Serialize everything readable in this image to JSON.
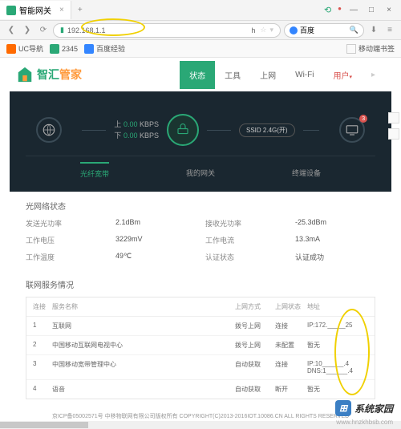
{
  "window": {
    "tab_title": "智能网关",
    "close": "×",
    "min": "—",
    "max": "□",
    "new_tab": "+"
  },
  "addr": {
    "back": "❮",
    "fwd": "❯",
    "reload": "⟳",
    "url": "192.168.1.1",
    "url_suffix": "h",
    "star": "☆",
    "search_engine": "百度",
    "search_icon": "🔍",
    "menu": "≡",
    "dl": "⬇"
  },
  "bookmarks": {
    "uc": "UC导航",
    "num": "2345",
    "baidu": "百度经验"
  },
  "right_bk": "移动端书签",
  "nav": {
    "status": "状态",
    "tools": "工具",
    "net": "上网",
    "wifi": "Wi-Fi",
    "user": "用户",
    "arrow": "▸"
  },
  "logo": {
    "text": "智汇管家"
  },
  "hero": {
    "up_label": "上",
    "up_val": "0.00",
    "up_unit": "KBPS",
    "down_label": "下",
    "down_val": "0.00",
    "down_unit": "KBPS",
    "ssid": "SSID 2.4G(开)",
    "badge": "3",
    "tab1": "光纤宽带",
    "tab2": "我的网关",
    "tab3": "终端设备"
  },
  "optical": {
    "title": "光网络状态",
    "r1k": "发送光功率",
    "r1v": "2.1dBm",
    "r1k2": "接收光功率",
    "r1v2": "-25.3dBm",
    "r2k": "工作电压",
    "r2v": "3229mV",
    "r2k2": "工作电流",
    "r2v2": "13.3mA",
    "r3k": "工作温度",
    "r3v": "49℃",
    "r3k2": "认证状态",
    "r3v2": "认证成功"
  },
  "svc": {
    "title": "联网服务情况",
    "h_idx": "连接",
    "h_name": "服务名称",
    "h_mode": "上网方式",
    "h_stat": "上网状态",
    "h_addr": "地址",
    "rows": [
      {
        "i": "1",
        "name": "互联网",
        "mode": "拨号上网",
        "stat": "连接",
        "addr": "IP:172._____25"
      },
      {
        "i": "2",
        "name": "中国移动互联网电视中心",
        "mode": "拨号上网",
        "stat": "未配置",
        "addr": "暂无"
      },
      {
        "i": "3",
        "name": "中国移动宽带管理中心",
        "mode": "自动获取",
        "stat": "连接",
        "addr": "IP:10______.4\nDNS:1______.4"
      },
      {
        "i": "4",
        "name": "语音",
        "mode": "自动获取",
        "stat": "断开",
        "addr": "暂无"
      }
    ]
  },
  "footer": "京ICP备05002571号 中移物联网有限公司版权所有 COPYRIGHT(C)2013-2016IOT.10086.CN ALL RIGHTS RESERVED",
  "watermark": {
    "text": "系统家园",
    "url": "www.hnzkhbsb.com"
  }
}
